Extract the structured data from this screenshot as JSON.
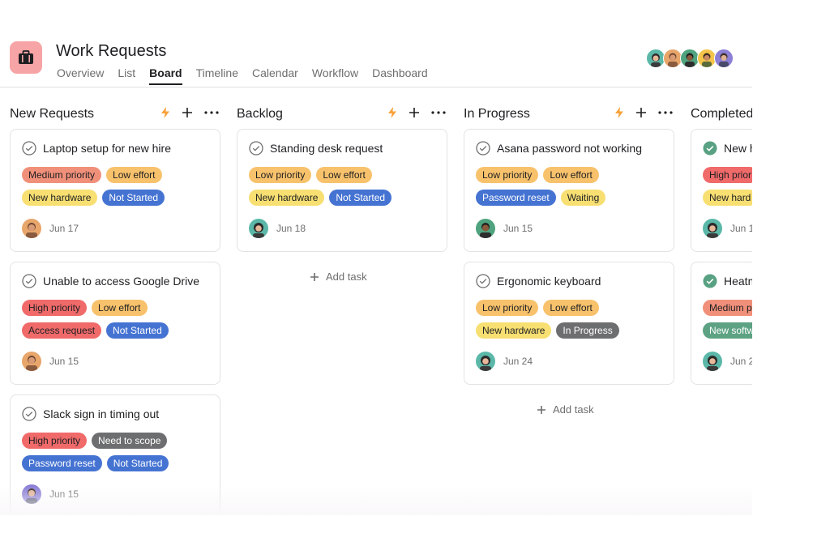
{
  "project": {
    "title": "Work Requests",
    "icon": "briefcase-icon",
    "icon_bg": "#f7a4a6"
  },
  "tabs": [
    "Overview",
    "List",
    "Board",
    "Timeline",
    "Calendar",
    "Workflow",
    "Dashboard"
  ],
  "active_tab": "Board",
  "columns": [
    {
      "title": "New Requests",
      "cards": [
        {
          "title": "Laptop setup for new hire",
          "completed": false,
          "tags": [
            "Medium priority",
            "Low effort"
          ],
          "tags2": [
            "New hardware",
            "Not Started"
          ],
          "due": "Jun 17"
        },
        {
          "title": "Unable to access Google Drive",
          "completed": false,
          "tags": [
            "High priority",
            "Low effort"
          ],
          "tags2": [
            "Access request",
            "Not Started"
          ],
          "due": "Jun 15"
        },
        {
          "title": "Slack sign in timing out",
          "completed": false,
          "tags": [
            "High priority",
            "Need to scope"
          ],
          "tags2": [
            "Password reset",
            "Not Started"
          ],
          "due": "Jun 15"
        }
      ]
    },
    {
      "title": "Backlog",
      "cards": [
        {
          "title": "Standing desk request",
          "completed": false,
          "tags": [
            "Low priority",
            "Low effort"
          ],
          "tags2": [
            "New hardware",
            "Not Started"
          ],
          "due": "Jun 18"
        }
      ],
      "add_task": "Add task"
    },
    {
      "title": "In Progress",
      "cards": [
        {
          "title": "Asana password not working",
          "completed": false,
          "tags": [
            "Low priority",
            "Low effort"
          ],
          "tags2": [
            "Password reset",
            "Waiting"
          ],
          "due": "Jun 15"
        },
        {
          "title": "Ergonomic keyboard",
          "completed": false,
          "tags": [
            "Low priority",
            "Low effort"
          ],
          "tags2": [
            "New hardware",
            "In Progress"
          ],
          "due": "Jun 24"
        }
      ],
      "add_task": "Add task"
    },
    {
      "title": "Completed",
      "cards": [
        {
          "title": "New h",
          "completed": true,
          "tags": [
            "High prior"
          ],
          "tags2": [
            "New hard"
          ],
          "due": "Jun 1"
        },
        {
          "title": "Heatm",
          "completed": true,
          "tags": [
            "Medium p"
          ],
          "tags2": [
            "New softw"
          ],
          "due": "Jun 2"
        }
      ]
    }
  ],
  "tag_colors": {
    "Medium priority": "#f1907a",
    "High priority": "#f06a6a",
    "Low priority": "#f8c26c",
    "Low effort": "#f8c26c",
    "Need to scope": "#6d6e6f",
    "New hardware": "#f8df72",
    "Not Started": "#4573d2",
    "Access request": "#f06a6a",
    "Password reset": "#4573d2",
    "Waiting": "#f8df72",
    "In Progress": "#6d6e6f",
    "New software": "#5da283"
  },
  "accent_colors": {
    "lightning": "#f8a23b",
    "check_complete": "#58a182"
  }
}
